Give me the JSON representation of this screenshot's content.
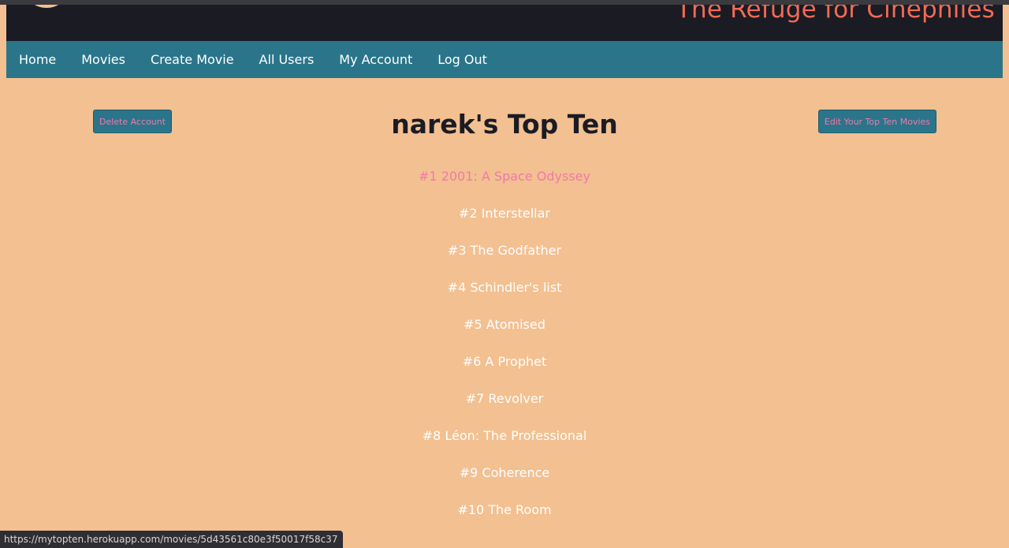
{
  "header": {
    "site_title": "The Refuge for Cinephiles"
  },
  "nav": {
    "items": [
      {
        "label": "Home"
      },
      {
        "label": "Movies"
      },
      {
        "label": "Create Movie"
      },
      {
        "label": "All Users"
      },
      {
        "label": "My Account"
      },
      {
        "label": "Log Out"
      }
    ]
  },
  "actions": {
    "delete_account": "Delete Account",
    "edit_top_ten": "Edit Your Top Ten Movies"
  },
  "page": {
    "title": "narek's Top Ten"
  },
  "movies": [
    {
      "label": "#1 2001: A Space Odyssey",
      "hovered": true
    },
    {
      "label": "#2 Interstellar"
    },
    {
      "label": "#3 The Godfather"
    },
    {
      "label": "#4 Schindler's list"
    },
    {
      "label": "#5 Atomised"
    },
    {
      "label": "#6 A Prophet"
    },
    {
      "label": "#7 Revolver"
    },
    {
      "label": "#8 Léon: The Professional"
    },
    {
      "label": "#9 Coherence"
    },
    {
      "label": "#10 The Room"
    }
  ],
  "status_bar": {
    "url": "https://mytopten.herokuapp.com/movies/5d43561c80e3f50017f58c37"
  },
  "colors": {
    "background": "#f3c091",
    "header": "#1b1b24",
    "nav": "#2a758a",
    "accent_title": "#f26b54",
    "link_hover": "#f07aa8"
  }
}
